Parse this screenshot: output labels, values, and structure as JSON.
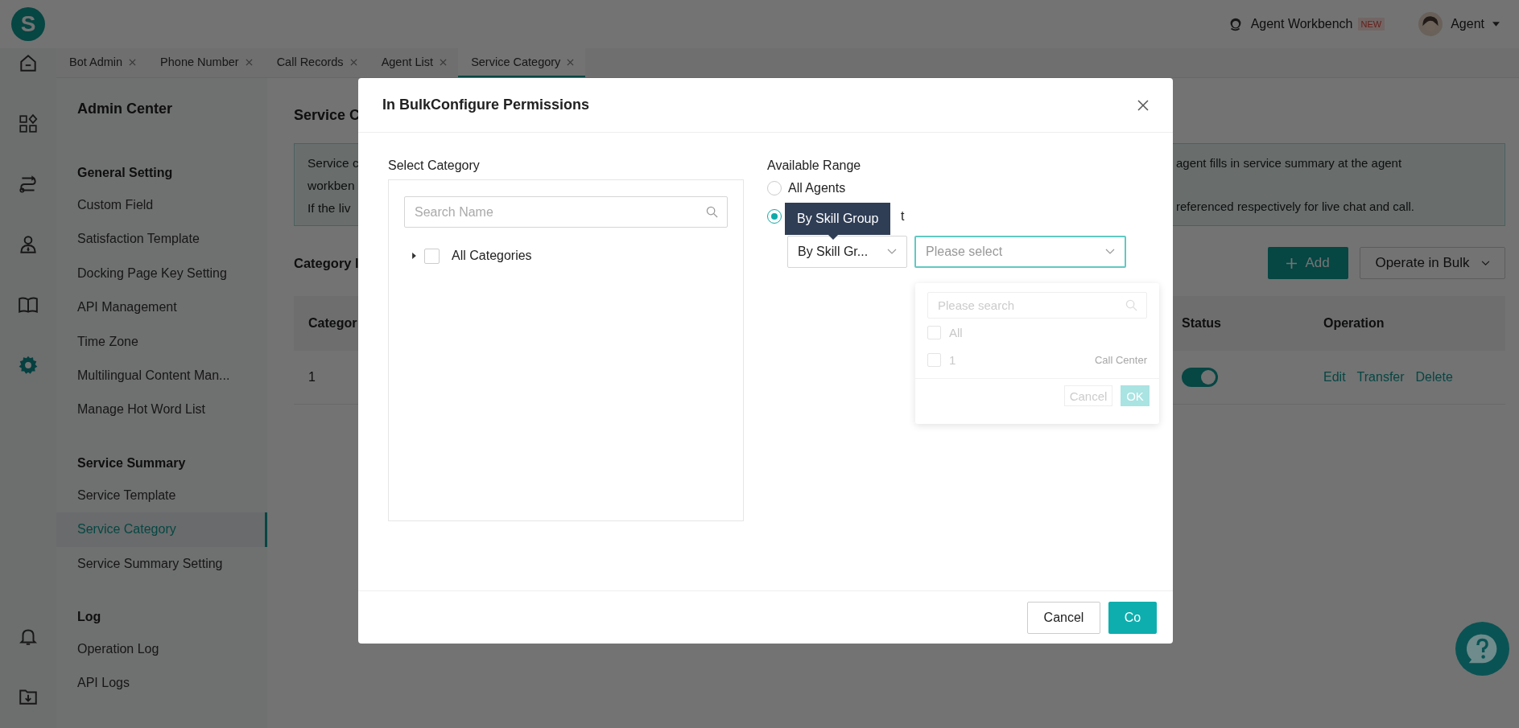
{
  "logo": {
    "letter": "S"
  },
  "header": {
    "workbench": "Agent Workbench",
    "badge": "NEW",
    "user": "Agent"
  },
  "rail": [
    {
      "kind": "home",
      "selected": false
    },
    {
      "kind": "apps",
      "selected": false
    },
    {
      "kind": "route",
      "selected": false
    },
    {
      "kind": "person",
      "selected": false
    },
    {
      "kind": "book",
      "selected": false
    },
    {
      "kind": "gear",
      "selected": true
    },
    {
      "kind": "bell",
      "selected": false
    },
    {
      "kind": "download",
      "selected": false
    }
  ],
  "tabs": [
    {
      "label": "Bot Admin",
      "selected": false
    },
    {
      "label": "Phone Number",
      "selected": false
    },
    {
      "label": "Call Records",
      "selected": false
    },
    {
      "label": "Agent List",
      "selected": false
    },
    {
      "label": "Service Category",
      "selected": true
    }
  ],
  "sidebar": {
    "title": "Admin Center",
    "groups": [
      {
        "heading": "General Setting",
        "items": [
          {
            "label": "Custom Field",
            "selected": false
          },
          {
            "label": "Satisfaction Template",
            "selected": false
          },
          {
            "label": "Docking Page Key Setting",
            "selected": false
          },
          {
            "label": "API Management",
            "selected": false
          },
          {
            "label": "Time Zone",
            "selected": false
          },
          {
            "label": "Multilingual Content Man...",
            "selected": false
          },
          {
            "label": "Manage Hot Word List",
            "selected": false
          }
        ]
      },
      {
        "heading": "Service Summary",
        "items": [
          {
            "label": "Service Template",
            "selected": false
          },
          {
            "label": "Service Category",
            "selected": true
          },
          {
            "label": "Service Summary Setting",
            "selected": false
          }
        ]
      },
      {
        "heading": "Log",
        "items": [
          {
            "label": "Operation Log",
            "selected": false
          },
          {
            "label": "API Logs",
            "selected": false
          }
        ]
      }
    ]
  },
  "page": {
    "title": "Service C",
    "notice": {
      "left_lines": [
        "Service c",
        "workben",
        "If the liv"
      ],
      "right_lines": [
        "agent fills in service summary at the agent",
        "referenced respectively for live chat and call."
      ]
    },
    "section_title": "Category l",
    "add_button": "Add",
    "bulk_button": "Operate in Bulk",
    "table": {
      "columns": [
        "Categor",
        "Status",
        "Operation"
      ],
      "rows": [
        {
          "cells": [
            "1"
          ],
          "status_on": true,
          "actions": [
            "Edit",
            "Transfer",
            "Delete"
          ]
        }
      ]
    }
  },
  "dialog": {
    "title": "In BulkConfigure Permissions",
    "left": {
      "label": "Select Category",
      "search_placeholder": "Search Name",
      "tree": [
        {
          "label": "All Categories",
          "checked": false,
          "expanded": false
        }
      ]
    },
    "right": {
      "label": "Available Range",
      "options": [
        {
          "label": "All Agents",
          "selected": false
        },
        {
          "label": "t",
          "selected": true
        }
      ],
      "tooltip": "By Skill Group",
      "mode_select": "By Skill Gr...",
      "target_placeholder": "Please select",
      "dropdown": {
        "search_placeholder": "Please search",
        "options": [
          {
            "label": "All",
            "checked": false
          },
          {
            "label": "1",
            "note": "Call Center",
            "checked": false
          }
        ],
        "cancel": "Cancel",
        "ok": "OK"
      }
    },
    "cancel": "Cancel",
    "confirm": "Co"
  }
}
